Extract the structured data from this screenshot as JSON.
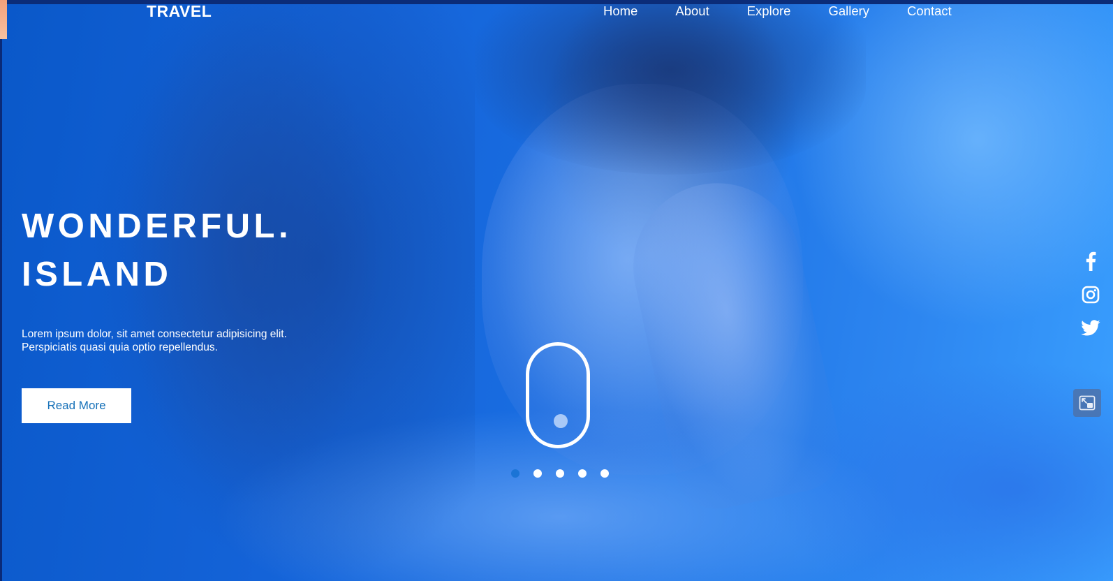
{
  "header": {
    "brand": "TRAVEL",
    "nav": [
      {
        "label": "Home"
      },
      {
        "label": "About"
      },
      {
        "label": "Explore"
      },
      {
        "label": "Gallery"
      },
      {
        "label": "Contact"
      }
    ]
  },
  "hero": {
    "title_line1": "WONDERFUL.",
    "title_line2": "ISLAND",
    "description_line1": "Lorem ipsum dolor, sit amet consectetur adipisicing elit.",
    "description_line2": "Perspiciatis quasi quia optio repellendus.",
    "cta_label": "Read More"
  },
  "slider": {
    "dot_count": 5,
    "active_index": 0
  },
  "social": {
    "icons": [
      "facebook-icon",
      "instagram-icon",
      "twitter-icon"
    ]
  },
  "colors": {
    "accent": "#1570b8",
    "active_dot": "#1b74d6",
    "background": "#1a6fe3"
  }
}
